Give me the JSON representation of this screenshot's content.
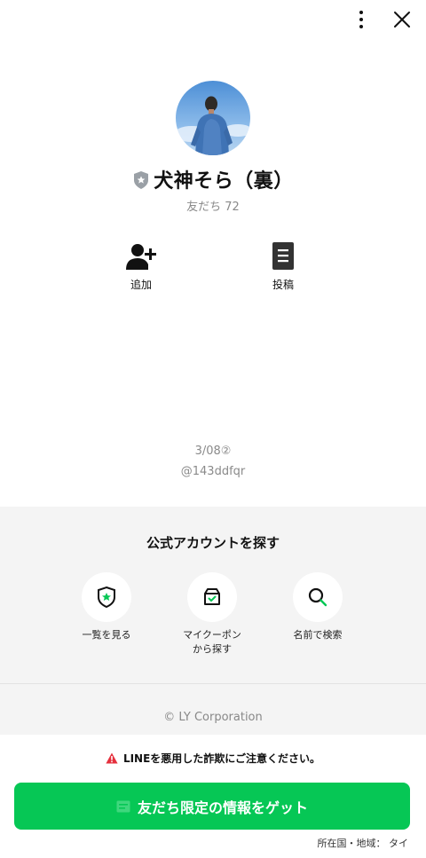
{
  "profile": {
    "name": "犬神そら（裏）",
    "friends_label": "友だち 72"
  },
  "actions": {
    "add_label": "追加",
    "posts_label": "投稿"
  },
  "status_message": "3/08②",
  "account_id": "@143ddfqr",
  "explore": {
    "title": "公式アカウントを探す",
    "items": [
      {
        "label": "一覧を見る",
        "icon": "shield-star-icon"
      },
      {
        "label": "マイクーポン\nから探す",
        "icon": "coupon-box-icon"
      },
      {
        "label": "名前で検索",
        "icon": "search-icon"
      }
    ]
  },
  "copyright": "© LY Corporation",
  "warning": {
    "text": "LINEを悪用した詐欺にご注意ください。",
    "color": "#e5303d"
  },
  "cta": {
    "label": "友だち限定の情報をゲット",
    "color": "#06c755"
  },
  "region": "所在国・地域： タイ"
}
